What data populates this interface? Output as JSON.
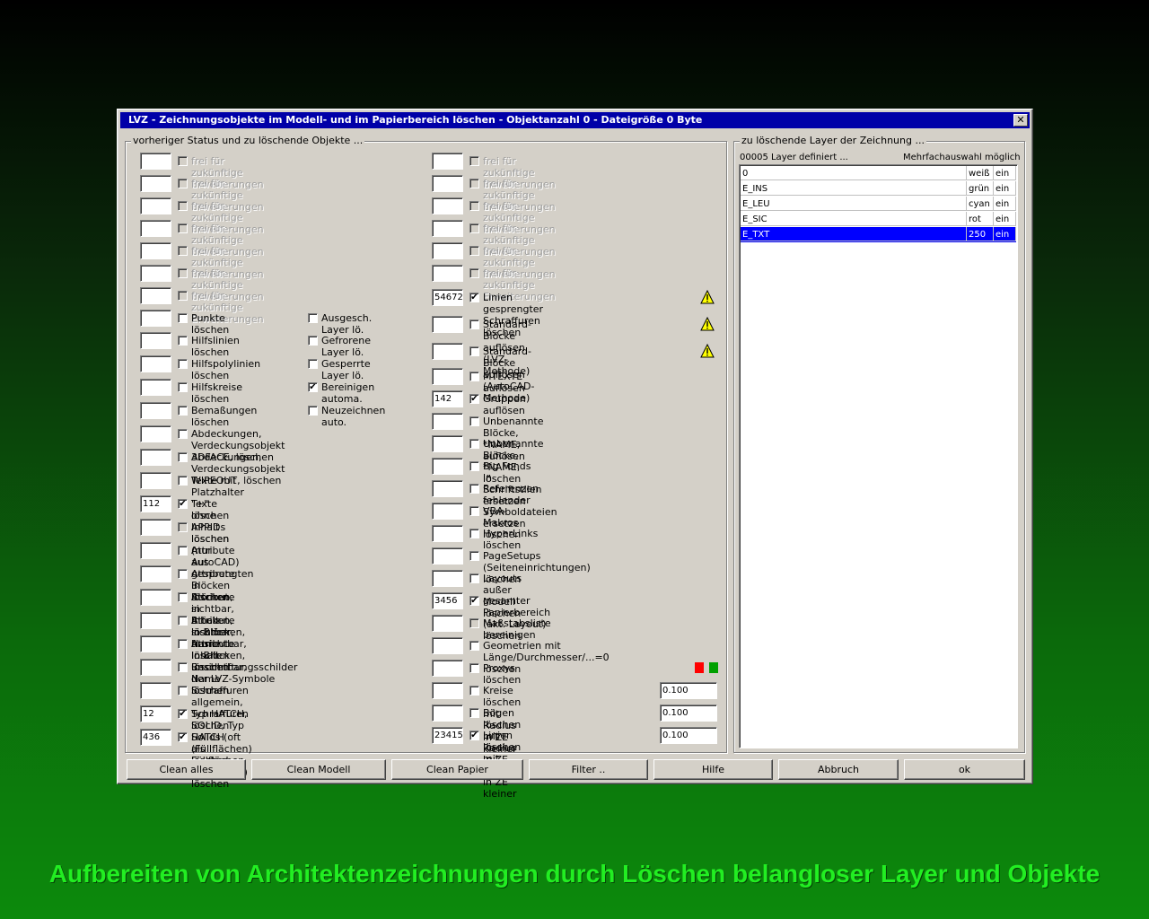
{
  "window": {
    "title": "LVZ - Zeichnungsobjekte im Modell- und im Papierbereich löschen - Objektanzahl 0 - Dateigröße 0 Byte",
    "close_glyph": "✕"
  },
  "left_group": {
    "label": "vorheriger Status und zu löschende Objekte ..."
  },
  "right_group": {
    "label": "zu löschende Layer der Zeichnung ...",
    "count_text": "00005 Layer definiert ...",
    "multi_text": "Mehrfachauswahl möglich",
    "layers": [
      {
        "name": "0",
        "color": "weiß",
        "state": "ein",
        "selected": false
      },
      {
        "name": "E_INS",
        "color": "grün",
        "state": "ein",
        "selected": false
      },
      {
        "name": "E_LEU",
        "color": "cyan",
        "state": "ein",
        "selected": false
      },
      {
        "name": "E_SIC",
        "color": "rot",
        "state": "ein",
        "selected": false
      },
      {
        "name": "E_TXT",
        "color": "250",
        "state": "ein",
        "selected": true
      }
    ]
  },
  "col1": [
    {
      "count": "",
      "checked": false,
      "disabled": true,
      "label": "frei für zukünftige Erweiterungen"
    },
    {
      "count": "",
      "checked": false,
      "disabled": true,
      "label": "frei für zukünftige Erweiterungen"
    },
    {
      "count": "",
      "checked": false,
      "disabled": true,
      "label": "frei für zukünftige Erweiterungen"
    },
    {
      "count": "",
      "checked": false,
      "disabled": true,
      "label": "frei für zukünftige Erweiterungen"
    },
    {
      "count": "",
      "checked": false,
      "disabled": true,
      "label": "frei für zukünftige Erweiterungen"
    },
    {
      "count": "",
      "checked": false,
      "disabled": true,
      "label": "frei für zukünftige Erweiterungen"
    },
    {
      "count": "",
      "checked": false,
      "disabled": true,
      "label": "frei für zukünftige Erweiterungen"
    },
    {
      "count": "",
      "checked": false,
      "disabled": false,
      "label": "Punkte löschen"
    },
    {
      "count": "",
      "checked": false,
      "disabled": false,
      "label": "Hilfslinien löschen"
    },
    {
      "count": "",
      "checked": false,
      "disabled": false,
      "label": "Hilfspolylinien löschen"
    },
    {
      "count": "",
      "checked": false,
      "disabled": false,
      "label": "Hilfskreise löschen"
    },
    {
      "count": "",
      "checked": false,
      "disabled": false,
      "label": "Bemaßungen löschen"
    },
    {
      "count": "",
      "checked": false,
      "disabled": false,
      "label": "Abdeckungen, Verdeckungsobjekt 3DFACE, löschen"
    },
    {
      "count": "",
      "checked": false,
      "disabled": false,
      "label": "Abdeckungen, Verdeckungsobjekt WIPEOUT, löschen"
    },
    {
      "count": "",
      "checked": false,
      "disabled": false,
      "label": "Texte mit Platzhalter \"+\" löschen"
    },
    {
      "count": "112",
      "checked": true,
      "disabled": false,
      "label": "Texte ohne Inhalt löschen"
    },
    {
      "count": "",
      "checked": false,
      "disabled": true,
      "label": "APPIDs löschen (nur AutoCAD)",
      "label_enabled": true
    },
    {
      "count": "",
      "checked": false,
      "disabled": false,
      "label": "Attribute aus gesprengten Blöcken löschen"
    },
    {
      "count": "",
      "checked": false,
      "disabled": false,
      "label": "Attribute in Blöcken, sichtbar, Inhalt löschen"
    },
    {
      "count": "",
      "checked": false,
      "disabled": false,
      "label": "Attribute in Blöcken, sichtbar, Name löschen"
    },
    {
      "count": "",
      "checked": false,
      "disabled": false,
      "label": "Attribute in Blöcken, unsichtbar, Inhalt löschen"
    },
    {
      "count": "",
      "checked": false,
      "disabled": false,
      "label": "Attribute in Blöcken, unsichtbar, Name löschen"
    },
    {
      "count": "",
      "checked": false,
      "disabled": false,
      "label": "Beschriftungsschilder der LVZ-Symbole löschen"
    },
    {
      "count": "",
      "checked": false,
      "disabled": false,
      "label": "Schraffuren allgemein, Typ HATCH, löschen"
    },
    {
      "count": "12",
      "checked": true,
      "disabled": false,
      "label": "Schraffuren SOLID, Typ HATCH (Füllflächen) löschen"
    },
    {
      "count": "436",
      "checked": true,
      "disabled": false,
      "label": "Solids (oft als Füllflächen verwendet) löschen"
    }
  ],
  "col1b": [
    {
      "checked": false,
      "label": "Ausgesch. Layer lö."
    },
    {
      "checked": false,
      "label": "Gefrorene Layer lö."
    },
    {
      "checked": false,
      "label": "Gesperrte Layer lö."
    },
    {
      "checked": true,
      "label": "Bereinigen automa."
    },
    {
      "checked": false,
      "label": "Neuzeichnen auto."
    }
  ],
  "col2": [
    {
      "count": "",
      "checked": false,
      "disabled": true,
      "label": "frei für zukünftige Erweiterungen"
    },
    {
      "count": "",
      "checked": false,
      "disabled": true,
      "label": "frei für zukünftige Erweiterungen"
    },
    {
      "count": "",
      "checked": false,
      "disabled": true,
      "label": "frei für zukünftige Erweiterungen"
    },
    {
      "count": "",
      "checked": false,
      "disabled": true,
      "label": "frei für zukünftige Erweiterungen"
    },
    {
      "count": "",
      "checked": false,
      "disabled": true,
      "label": "frei für zukünftige Erweiterungen"
    },
    {
      "count": "",
      "checked": false,
      "disabled": true,
      "label": "frei für zukünftige Erweiterungen"
    },
    {
      "count": "54672",
      "checked": true,
      "disabled": false,
      "label": "Linien gesprengter Schraffuren löschen",
      "warn": true
    },
    {
      "count": "",
      "checked": false,
      "disabled": false,
      "label": "Standard-Blöcke auflösen (LVZ-Methode)",
      "warn": true
    },
    {
      "count": "",
      "checked": false,
      "disabled": false,
      "label": "Standard-Blöcke auflösen (AutoCAD-Methode)",
      "warn": true
    },
    {
      "count": "",
      "checked": false,
      "disabled": false,
      "label": "MTEXTE auflösen"
    },
    {
      "count": "142",
      "checked": true,
      "disabled": false,
      "label": "Gruppen auflösen"
    },
    {
      "count": "",
      "checked": false,
      "disabled": false,
      "label": "Unbenannte Blöcke, *NAME, auflösen"
    },
    {
      "count": "",
      "checked": false,
      "disabled": false,
      "label": "Unbenannte Blöcke, *NAME, löschen"
    },
    {
      "count": "",
      "checked": false,
      "disabled": false,
      "label": "Big Fonds in Schriftstilen ersetzen"
    },
    {
      "count": "",
      "checked": false,
      "disabled": false,
      "label": "Referenzen fehlender Symboldateien ersetzen"
    },
    {
      "count": "",
      "checked": false,
      "disabled": false,
      "label": "VBA-Makros löschen"
    },
    {
      "count": "",
      "checked": false,
      "disabled": false,
      "label": "HyperLinks löschen"
    },
    {
      "count": "",
      "checked": false,
      "disabled": false,
      "label": "PageSetups (Seiteneinrichtungen) löschen"
    },
    {
      "count": "",
      "checked": false,
      "disabled": false,
      "label": "Layouts außer Modell löschen"
    },
    {
      "count": "3456",
      "checked": true,
      "disabled": false,
      "label": "gesamter Papierbereich (akt. Layout) löschen"
    },
    {
      "count": "",
      "checked": false,
      "disabled": true,
      "label": "Maßstabsliste bereinigen",
      "label_enabled": true
    },
    {
      "count": "",
      "checked": false,
      "disabled": false,
      "label": "Geometrien mit Länge/Durchmesser/...=0 löschen"
    },
    {
      "count": "",
      "checked": false,
      "disabled": false,
      "label": "Proxys löschen",
      "flags": true
    },
    {
      "count": "",
      "checked": false,
      "disabled": false,
      "label": "Kreise löschen mit Radius in ZE kleiner",
      "value": "0.100"
    },
    {
      "count": "",
      "checked": false,
      "disabled": false,
      "label": "Bögen löschen mit Radius in ZE kleiner",
      "value": "0.100"
    },
    {
      "count": "23415",
      "checked": true,
      "disabled": false,
      "label": "Linien löschen mit Länge in ZE kleiner",
      "value": "0.100"
    }
  ],
  "buttons": [
    {
      "name": "clean-all-button",
      "label": "Clean alles"
    },
    {
      "name": "clean-model-button",
      "label": "Clean Modell"
    },
    {
      "name": "clean-paper-button",
      "label": "Clean Papier"
    },
    {
      "name": "filter-button",
      "label": "Filter .."
    },
    {
      "name": "help-button",
      "label": "Hilfe"
    },
    {
      "name": "cancel-button",
      "label": "Abbruch"
    },
    {
      "name": "ok-button",
      "label": "ok"
    }
  ],
  "colors": {
    "flag_red": "#ff0000",
    "flag_green": "#00a000",
    "selection": "#0000ff",
    "caption": "#22ee22"
  },
  "caption": "Aufbereiten von Architektenzeichnungen durch Löschen belangloser Layer und Objekte"
}
